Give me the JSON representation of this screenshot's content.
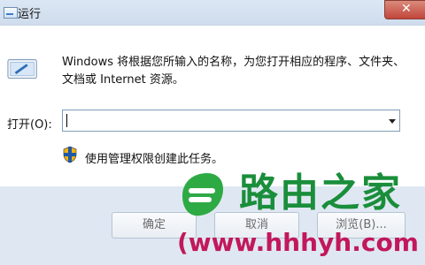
{
  "window": {
    "title": "运行",
    "close_symbol": "✕"
  },
  "main": {
    "description": "Windows 将根据您所输入的名称，为您打开相应的程序、文件夹、文档或 Internet 资源。",
    "open_label": "打开(O):",
    "open_value": "",
    "admin_note": "使用管理权限创建此任务。"
  },
  "buttons": {
    "ok": "确定",
    "cancel": "取消",
    "browse": "浏览(B)..."
  },
  "watermark": {
    "text": "路由之家",
    "url": "(www.hhhyh.com"
  },
  "colors": {
    "title_bg": "#d6e3f2",
    "close_red": "#c2453a",
    "watermark_green": "#1a8e3b",
    "watermark_pink": "#c2185b"
  },
  "icons": {
    "title": "run-icon",
    "close": "close-icon",
    "run": "run-icon",
    "shield": "shield-icon",
    "dropdown": "chevron-down-icon"
  }
}
